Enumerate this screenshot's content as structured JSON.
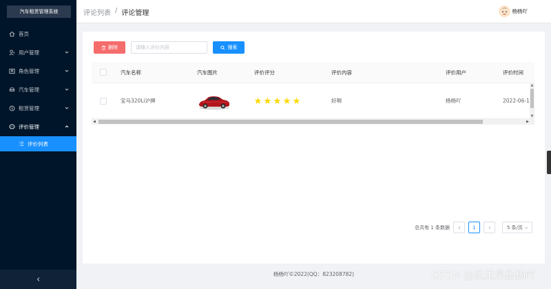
{
  "app": {
    "logo_text": "汽车租赁管理系统"
  },
  "sidebar": {
    "items": [
      {
        "label": "首页",
        "icon": "home-icon",
        "expandable": false
      },
      {
        "label": "用户管理",
        "icon": "user-icon",
        "expandable": true
      },
      {
        "label": "角色管理",
        "icon": "role-icon",
        "expandable": true
      },
      {
        "label": "汽车管理",
        "icon": "car-icon",
        "expandable": true
      },
      {
        "label": "租赁管理",
        "icon": "rent-icon",
        "expandable": true
      },
      {
        "label": "评价管理",
        "icon": "comment-icon",
        "expandable": true,
        "open": true
      }
    ],
    "active_sub_item": {
      "label": "评价列表",
      "icon": "list-icon"
    }
  },
  "header": {
    "breadcrumb": [
      "评论列表",
      "评论管理"
    ],
    "separator": "/",
    "username": "杨杨吖"
  },
  "toolbar": {
    "delete_label": "删除",
    "search_placeholder": "请输入评价内容",
    "search_value": "",
    "search_label": "搜索"
  },
  "table": {
    "columns": [
      "汽车名称",
      "汽车图片",
      "评价评分",
      "评价内容",
      "评价用户",
      "评价时间"
    ],
    "rows": [
      {
        "car_name": "宝马320Li沪牌",
        "image": "red-car-image",
        "rating": 5,
        "content": "好啊",
        "user": "杨杨吖",
        "time": "2022-06-1"
      }
    ]
  },
  "pagination": {
    "total_text": "总共有 1 条数据",
    "current_page": "1",
    "page_size": "5 条/页"
  },
  "footer": {
    "text": "杨杨吖©2022(QQ：823208782)"
  },
  "watermark": {
    "text": "CSDN @这里是杨杨吖"
  },
  "colors": {
    "sidebar_bg": "#001529",
    "primary": "#1890ff",
    "danger": "#f56c6c",
    "star": "#fadb14"
  }
}
